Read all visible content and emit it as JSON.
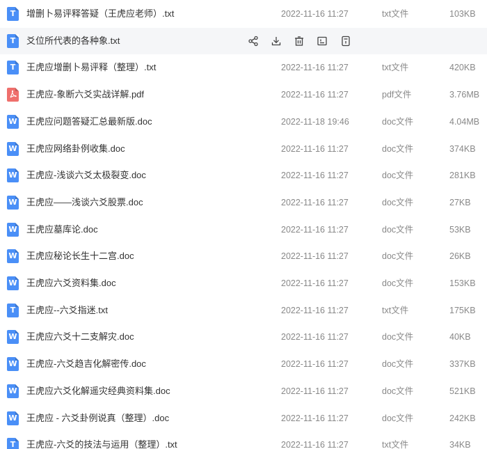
{
  "files": [
    {
      "name": "增删卜易评释答疑（王虎应老师）.txt",
      "date": "2022-11-16 11:27",
      "type": "txt文件",
      "size": "103KB",
      "kind": "txt",
      "icon_letter": "T",
      "icon": "txt-file-icon"
    },
    {
      "name": "爻位所代表的各种象.txt",
      "date": "",
      "type": "",
      "size": "",
      "kind": "txt",
      "icon_letter": "T",
      "icon": "txt-file-icon"
    },
    {
      "name": "王虎应增删卜易评释（整理）.txt",
      "date": "2022-11-16 11:27",
      "type": "txt文件",
      "size": "420KB",
      "kind": "txt",
      "icon_letter": "T",
      "icon": "txt-file-icon"
    },
    {
      "name": "王虎应-象断六爻实战详解.pdf",
      "date": "2022-11-16 11:27",
      "type": "pdf文件",
      "size": "3.76MB",
      "kind": "pdf",
      "icon_letter": "",
      "icon": "pdf-file-icon"
    },
    {
      "name": "王虎应问题答疑汇总最新版.doc",
      "date": "2022-11-18 19:46",
      "type": "doc文件",
      "size": "4.04MB",
      "kind": "doc",
      "icon_letter": "W",
      "icon": "doc-file-icon"
    },
    {
      "name": "王虎应网络卦例收集.doc",
      "date": "2022-11-16 11:27",
      "type": "doc文件",
      "size": "374KB",
      "kind": "doc",
      "icon_letter": "W",
      "icon": "doc-file-icon"
    },
    {
      "name": "王虎应-浅谈六爻太极裂变.doc",
      "date": "2022-11-16 11:27",
      "type": "doc文件",
      "size": "281KB",
      "kind": "doc",
      "icon_letter": "W",
      "icon": "doc-file-icon"
    },
    {
      "name": "王虎应——浅谈六爻股票.doc",
      "date": "2022-11-16 11:27",
      "type": "doc文件",
      "size": "27KB",
      "kind": "doc",
      "icon_letter": "W",
      "icon": "doc-file-icon"
    },
    {
      "name": "王虎应墓库论.doc",
      "date": "2022-11-16 11:27",
      "type": "doc文件",
      "size": "53KB",
      "kind": "doc",
      "icon_letter": "W",
      "icon": "doc-file-icon"
    },
    {
      "name": "王虎应秘论长生十二宫.doc",
      "date": "2022-11-16 11:27",
      "type": "doc文件",
      "size": "26KB",
      "kind": "doc",
      "icon_letter": "W",
      "icon": "doc-file-icon"
    },
    {
      "name": "王虎应六爻资料集.doc",
      "date": "2022-11-16 11:27",
      "type": "doc文件",
      "size": "153KB",
      "kind": "doc",
      "icon_letter": "W",
      "icon": "doc-file-icon"
    },
    {
      "name": "王虎应--六爻指迷.txt",
      "date": "2022-11-16 11:27",
      "type": "txt文件",
      "size": "175KB",
      "kind": "txt",
      "icon_letter": "T",
      "icon": "txt-file-icon"
    },
    {
      "name": "王虎应六爻十二支解灾.doc",
      "date": "2022-11-16 11:27",
      "type": "doc文件",
      "size": "40KB",
      "kind": "doc",
      "icon_letter": "W",
      "icon": "doc-file-icon"
    },
    {
      "name": "王虎应-六爻趋吉化解密传.doc",
      "date": "2022-11-16 11:27",
      "type": "doc文件",
      "size": "337KB",
      "kind": "doc",
      "icon_letter": "W",
      "icon": "doc-file-icon"
    },
    {
      "name": "王虎应六爻化解遥灾经典资料集.doc",
      "date": "2022-11-16 11:27",
      "type": "doc文件",
      "size": "521KB",
      "kind": "doc",
      "icon_letter": "W",
      "icon": "doc-file-icon"
    },
    {
      "name": "王虎应 - 六爻卦例说真（整理）.doc",
      "date": "2022-11-16 11:27",
      "type": "doc文件",
      "size": "242KB",
      "kind": "doc",
      "icon_letter": "W",
      "icon": "doc-file-icon"
    },
    {
      "name": "王虎应-六爻的技法与运用（整理）.txt",
      "date": "2022-11-16 11:27",
      "type": "txt文件",
      "size": "34KB",
      "kind": "txt",
      "icon_letter": "T",
      "icon": "txt-file-icon"
    }
  ],
  "hover_row_index": 1,
  "hover_actions": [
    {
      "icon": "share-icon"
    },
    {
      "icon": "download-icon"
    },
    {
      "icon": "delete-icon"
    },
    {
      "icon": "rename-icon"
    },
    {
      "icon": "more-icon"
    }
  ],
  "colors": {
    "txt_icon": "#4a8ff7",
    "doc_icon": "#4a8ff7",
    "pdf_icon": "#ef6f6c",
    "hover_bg": "#f5f6f8",
    "meta_text": "#888888",
    "name_text": "#333333"
  }
}
